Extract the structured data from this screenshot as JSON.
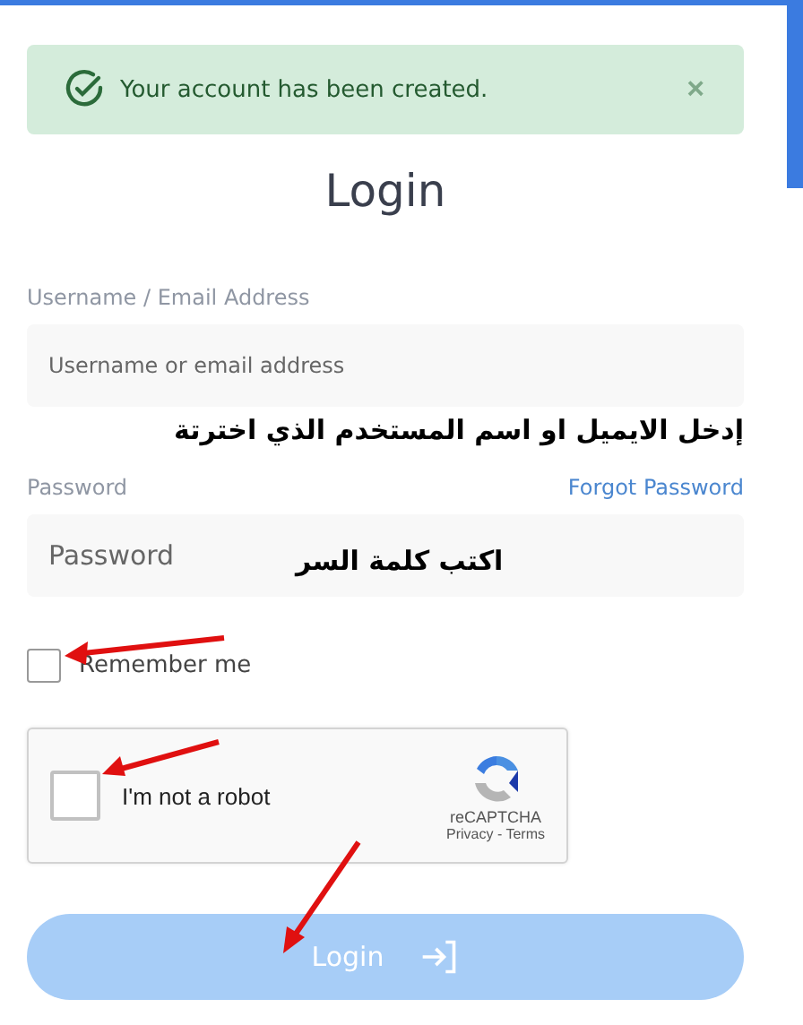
{
  "alert": {
    "message": "Your account has been created.",
    "close": "×"
  },
  "title": "Login",
  "username": {
    "label": "Username / Email Address",
    "placeholder": "Username or email address",
    "note": "إدخل الايميل او اسم المستخدم الذي اخترتة"
  },
  "password": {
    "label": "Password",
    "forgot_link": "Forgot Password",
    "placeholder": "Password",
    "note": "اكتب كلمة السر"
  },
  "remember": {
    "label": "Remember me",
    "checked": false
  },
  "captcha": {
    "label": "I'm not a robot",
    "checked": false,
    "brand": "reCAPTCHA",
    "links": "Privacy - Terms"
  },
  "login_button": {
    "label": "Login",
    "disabled": true
  }
}
